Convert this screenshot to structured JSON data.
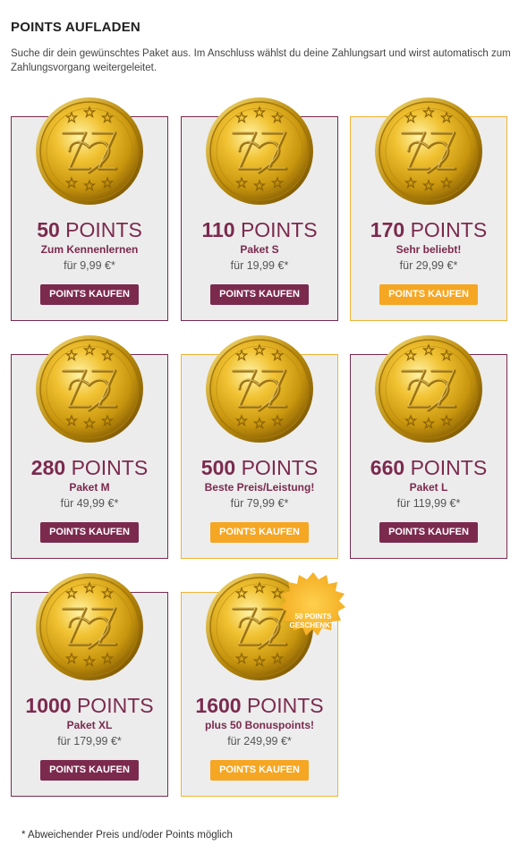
{
  "header": {
    "title": "POINTS AUFLADEN",
    "intro": "Suche dir dein gewünschtes Paket aus. Im Anschluss wählst du deine Zahlungsart und wirst automatisch zum Zahlungsvorgang weitergeleitet."
  },
  "packages": [
    {
      "amount": "50",
      "unit": "POINTS",
      "subtitle": "Zum Kennenlernen",
      "price": "für 9,99 €*",
      "button": "POINTS KAUFEN",
      "featured": false
    },
    {
      "amount": "110",
      "unit": "POINTS",
      "subtitle": "Paket S",
      "price": "für 19,99 €*",
      "button": "POINTS KAUFEN",
      "featured": false
    },
    {
      "amount": "170",
      "unit": "POINTS",
      "subtitle": "Sehr beliebt!",
      "price": "für 29,99 €*",
      "button": "POINTS KAUFEN",
      "featured": true
    },
    {
      "amount": "280",
      "unit": "POINTS",
      "subtitle": "Paket M",
      "price": "für 49,99 €*",
      "button": "POINTS KAUFEN",
      "featured": false
    },
    {
      "amount": "500",
      "unit": "POINTS",
      "subtitle": "Beste Preis/Leistung!",
      "price": "für 79,99 €*",
      "button": "POINTS KAUFEN",
      "featured": true
    },
    {
      "amount": "660",
      "unit": "POINTS",
      "subtitle": "Paket L",
      "price": "für 119,99 €*",
      "button": "POINTS KAUFEN",
      "featured": false
    },
    {
      "amount": "1000",
      "unit": "POINTS",
      "subtitle": "Paket XL",
      "price": "für 179,99 €*",
      "button": "POINTS KAUFEN",
      "featured": false
    },
    {
      "amount": "1600",
      "unit": "POINTS",
      "subtitle": "plus 50 Bonuspoints!",
      "price": "für 249,99 €*",
      "button": "POINTS KAUFEN",
      "featured": true,
      "badge": {
        "line1": "50 POINTS",
        "line2": "GESCHENKT!"
      }
    }
  ],
  "footnote": "* Abweichender Preis und/oder Points möglich",
  "colors": {
    "brand": "#7b2a4e",
    "accent": "#f5a623",
    "featured_border": "#f0b436",
    "coin_gold": "#d4a017"
  },
  "icons": {
    "coin": "coin-icon",
    "badge": "starburst-badge"
  }
}
